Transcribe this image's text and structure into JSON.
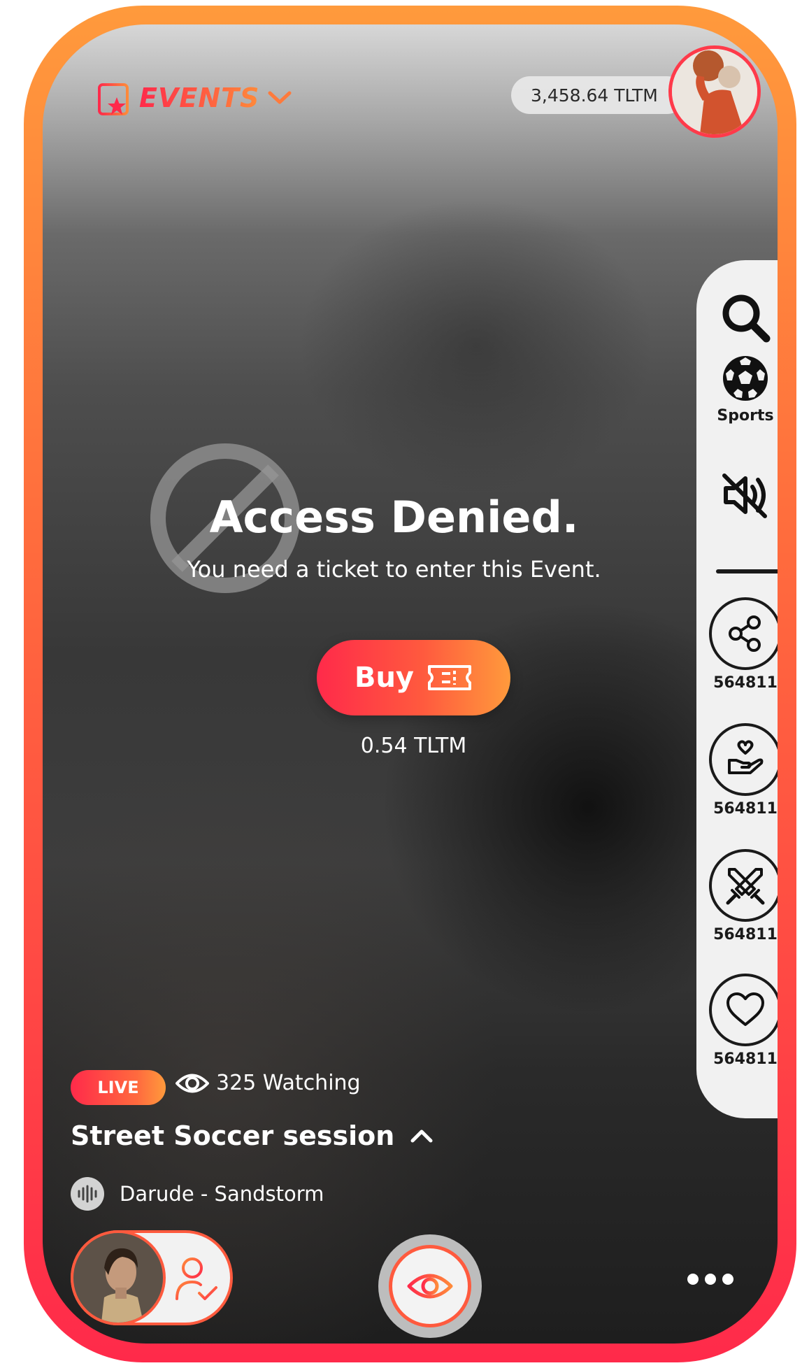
{
  "header": {
    "events_label": "EVENTS",
    "balance": "3,458.64 TLTM"
  },
  "side_rail": {
    "sports_label": "Sports",
    "share_count": "564811",
    "donate_count": "564811",
    "battle_count": "564811",
    "like_count": "564811"
  },
  "access": {
    "title": "Access Denied.",
    "subtitle": "You need a ticket to enter this Event.",
    "buy_label": "Buy",
    "price": "0.54 TLTM"
  },
  "stream": {
    "live_label": "LIVE",
    "watching": "325 Watching",
    "title": "Street Soccer session",
    "music": "Darude - Sandstorm"
  },
  "colors": {
    "accent_red": "#ff2a4a",
    "accent_orange": "#ff9a3c"
  }
}
